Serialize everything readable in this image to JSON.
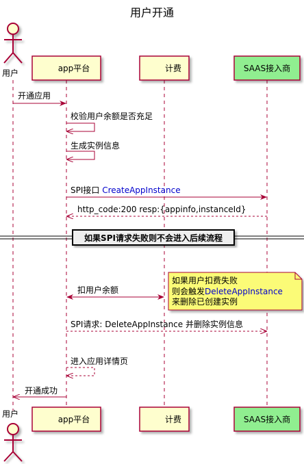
{
  "title": "用户开通",
  "participants": {
    "user": "用户",
    "app": "app平台",
    "billing": "计费",
    "saas": "SAAS接入商"
  },
  "messages": {
    "m1": "开通应用",
    "m2": "校验用户余额是否充足",
    "m3": "生成实例信息",
    "m4_prefix": "SPI接口 ",
    "m4_link": "CreateAppInstance",
    "m5": "http_code:200 resp:{appinfo,instanceId}",
    "m6": "扣用户余额",
    "m7": "SPI请求: DeleteAppInstance 并删除实例信息",
    "m8": "进入应用详情页",
    "m9": "开通成功"
  },
  "divider": "如果SPI请求失败则不会进入后续流程",
  "note": {
    "line1": "如果用户扣费失败",
    "line2_prefix": "则会触发",
    "line2_link": "DeleteAppInstance",
    "line3": "来删除已创建实例"
  },
  "colors": {
    "arrow": "#A80036",
    "participant_fill": "#FEFECE",
    "saas_fill": "#90EE90",
    "note_fill": "#FBFB77",
    "link": "#0000CC"
  }
}
